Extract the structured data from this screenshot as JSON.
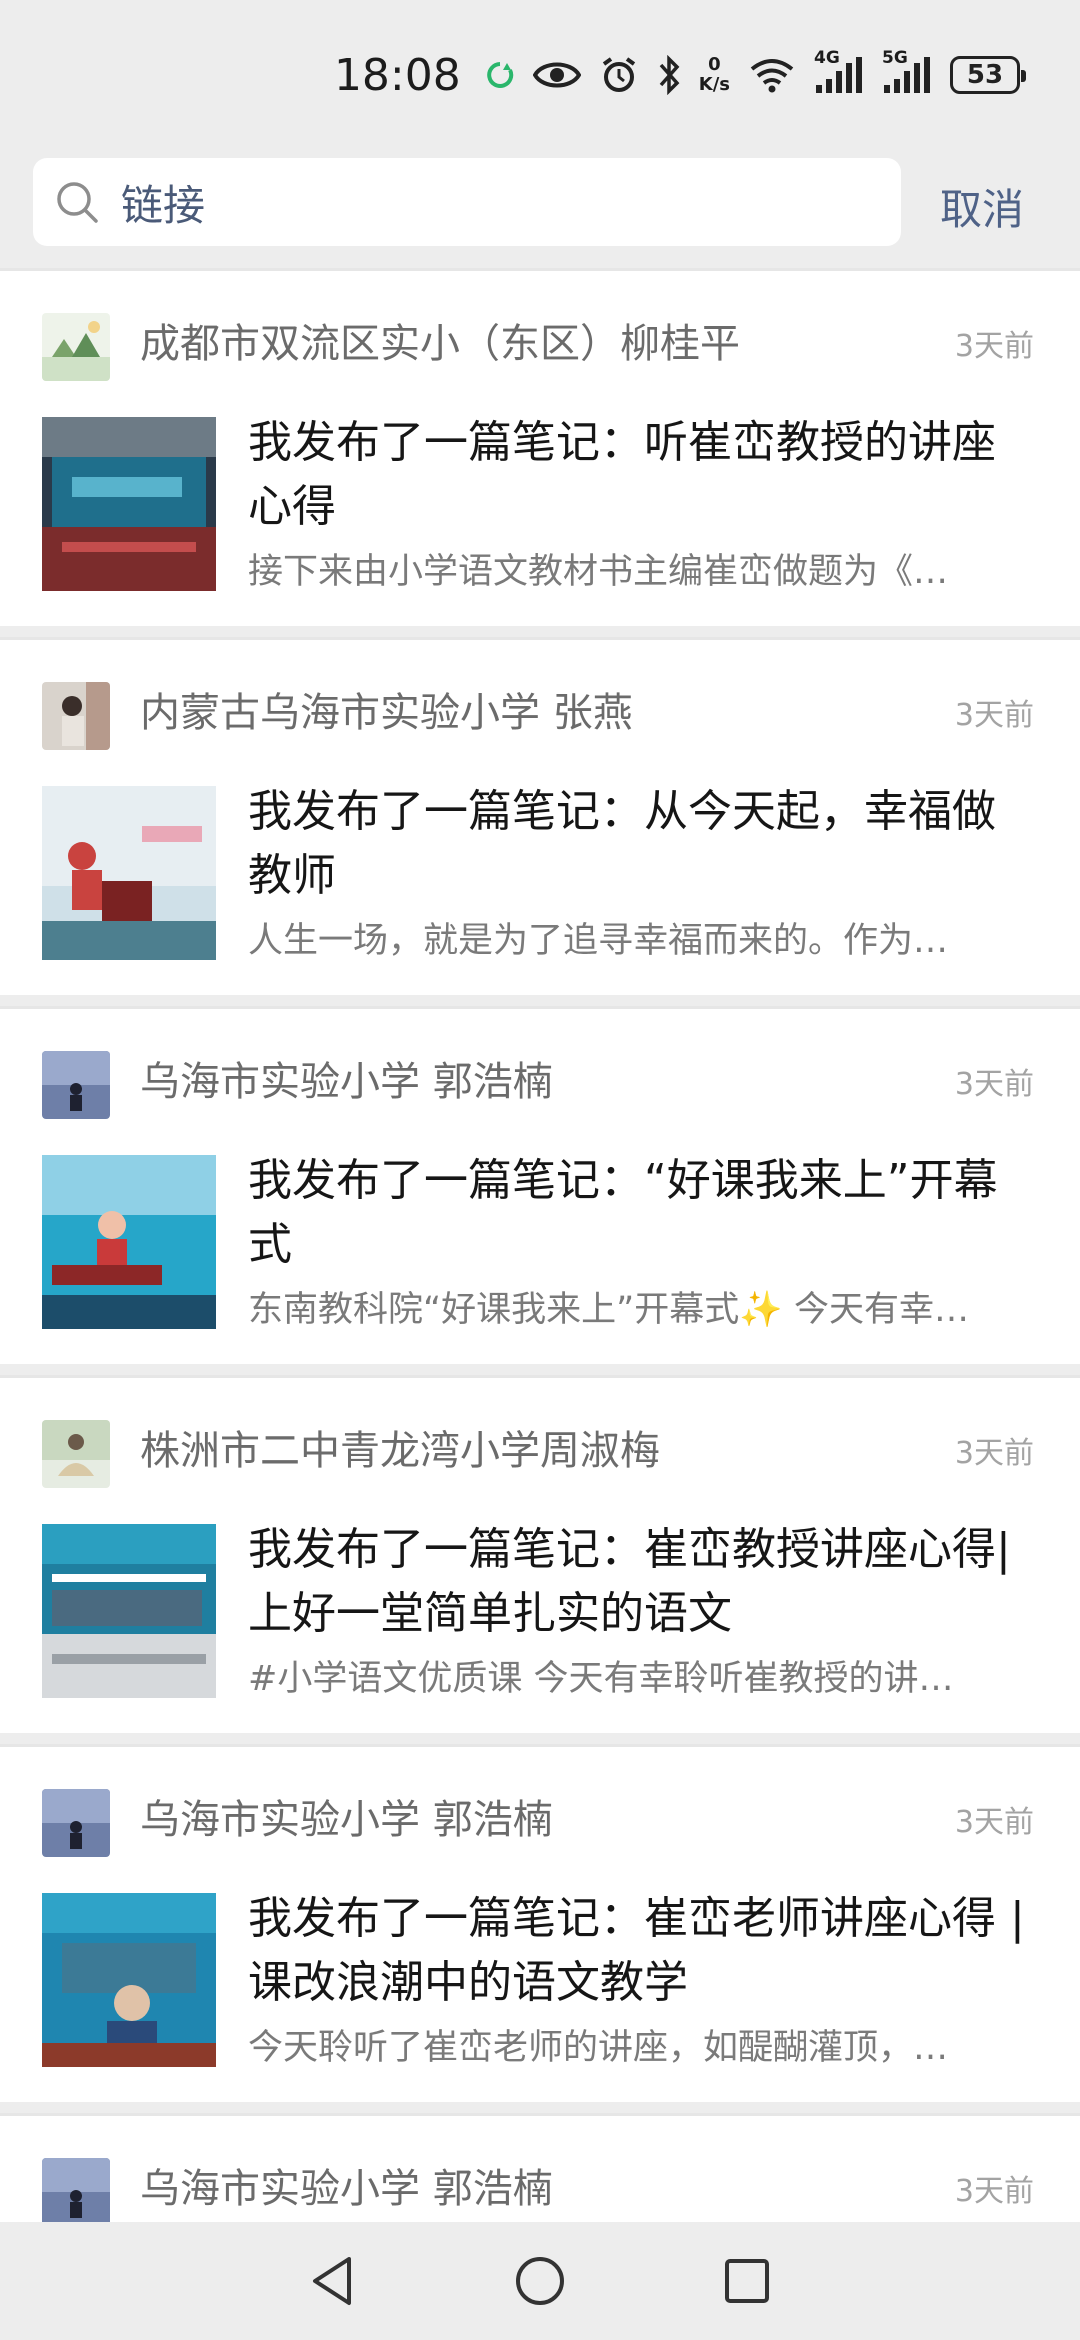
{
  "status_bar": {
    "time": "18:08",
    "speed_value": "0",
    "speed_unit": "K/s",
    "net1": "4G",
    "net2": "5G",
    "battery": "53"
  },
  "search": {
    "value": "链接",
    "cancel_label": "取消"
  },
  "feed": [
    {
      "author": "成都市双流区实小（东区）柳桂平",
      "time": "3天前",
      "title": "我发布了一篇笔记：听崔峦教授的讲座心得",
      "snippet": "接下来由小学语文教材书主编崔峦做题为《…"
    },
    {
      "author": "内蒙古乌海市实验小学  张燕",
      "time": "3天前",
      "title": "我发布了一篇笔记：从今天起，幸福做教师",
      "snippet": "人生一场，就是为了追寻幸福而来的。作为…"
    },
    {
      "author": "乌海市实验小学 郭浩楠",
      "time": "3天前",
      "title": "我发布了一篇笔记：“好课我来上”开幕式",
      "snippet": "东南教科院“好课我来上”开幕式✨ 今天有幸…"
    },
    {
      "author": "株洲市二中青龙湾小学周淑梅",
      "time": "3天前",
      "title": "我发布了一篇笔记：崔峦教授讲座心得|上好一堂简单扎实的语文",
      "snippet": "#小学语文优质课  今天有幸聆听崔教授的讲…"
    },
    {
      "author": "乌海市实验小学 郭浩楠",
      "time": "3天前",
      "title": "我发布了一篇笔记：崔峦老师讲座心得 | 课改浪潮中的语文教学",
      "snippet": "今天聆听了崔峦老师的讲座，如醍醐灌顶，…"
    },
    {
      "author": "乌海市实验小学 郭浩楠",
      "time": "3天前"
    }
  ],
  "colors": {
    "background": "#ededed",
    "card": "#ffffff",
    "link_blue": "#4f6287",
    "title_text": "#161616",
    "meta_text": "#a3a3a3"
  },
  "icons": {
    "search": "search-icon",
    "back": "back-triangle-icon",
    "home": "home-circle-icon",
    "recents": "recents-square-icon"
  }
}
